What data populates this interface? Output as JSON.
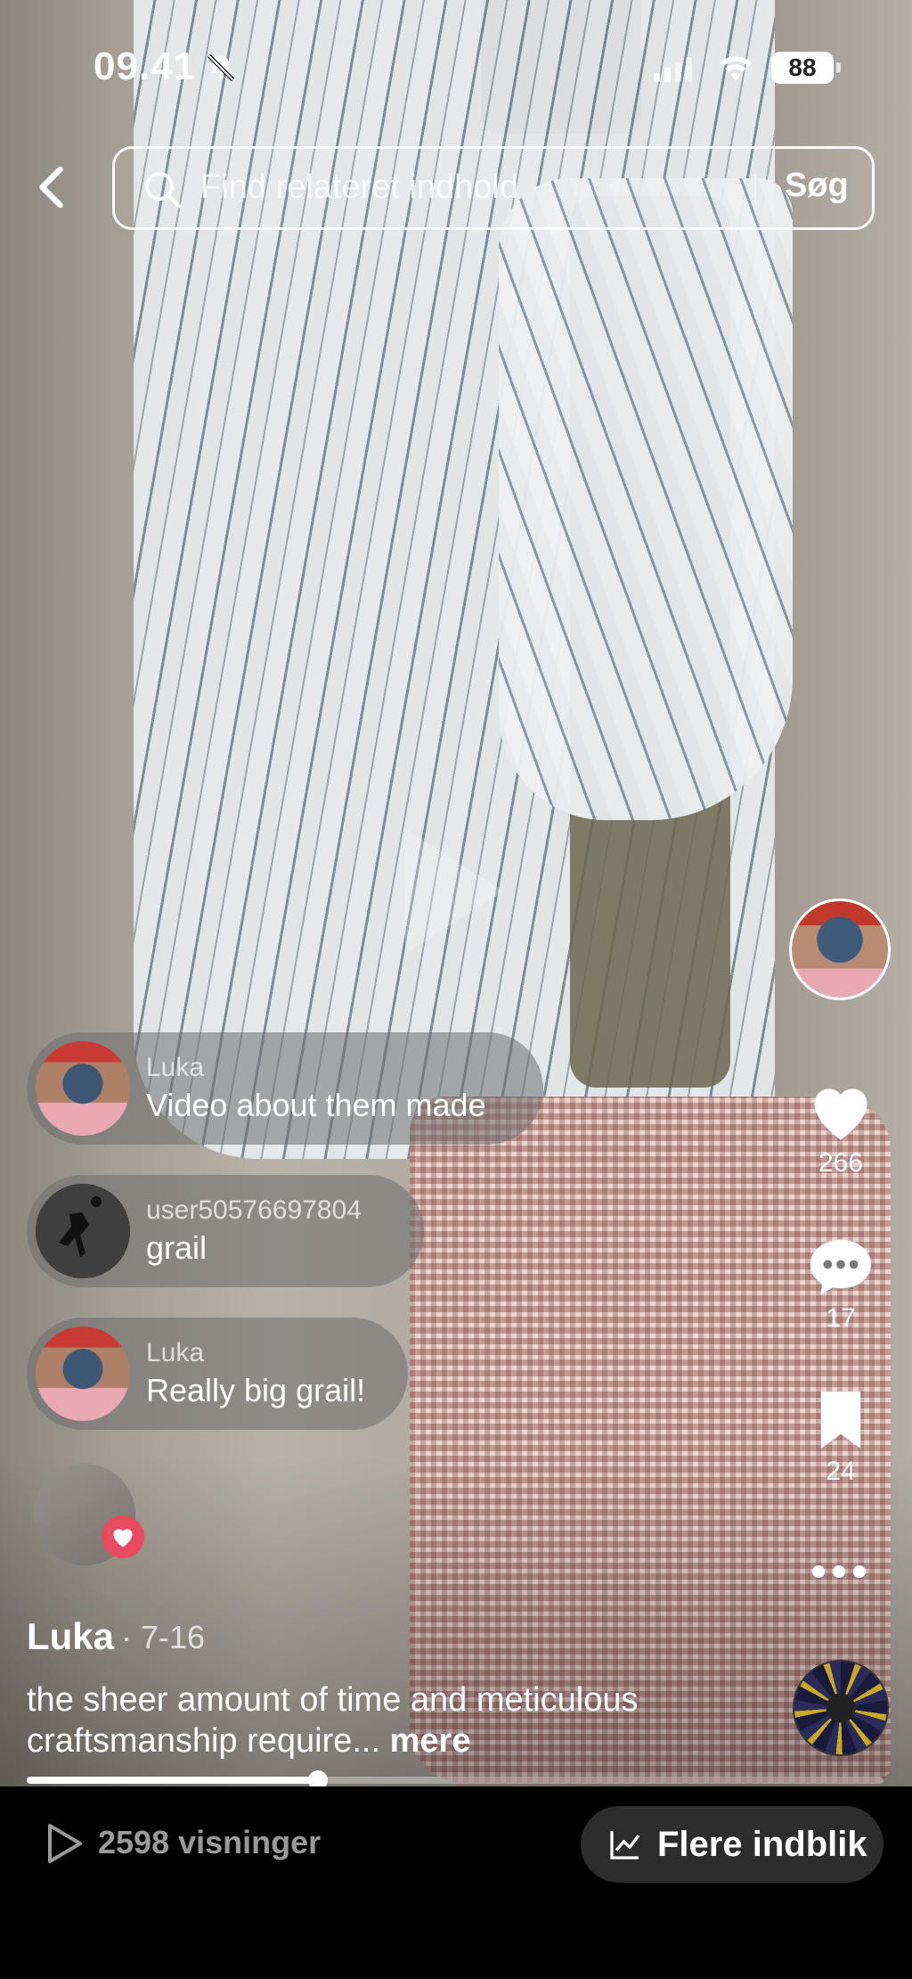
{
  "status_bar": {
    "time": "09.41",
    "battery": "88"
  },
  "search": {
    "placeholder": "Find relateret indhold",
    "button_label": "Søg"
  },
  "actions": {
    "likes": "266",
    "comments": "17",
    "saves": "24"
  },
  "comments": [
    {
      "name": "Luka",
      "text": "Video about them made"
    },
    {
      "name": "user50576697804",
      "text": "grail"
    },
    {
      "name": "Luka",
      "text": "Really big grail!"
    }
  ],
  "post": {
    "author": "Luka",
    "date": "· 7-16",
    "caption": "the sheer amount of time and meticulous craftsmanship require...",
    "more_label": "mere"
  },
  "playback": {
    "progress_fraction": 0.34
  },
  "footer": {
    "views": "2598 visninger",
    "insights_label": "Flere indblik"
  },
  "colors": {
    "like_badge": "#e84a5f",
    "bottom_bar": "#000000",
    "insights_button": "#2d2d2d"
  }
}
